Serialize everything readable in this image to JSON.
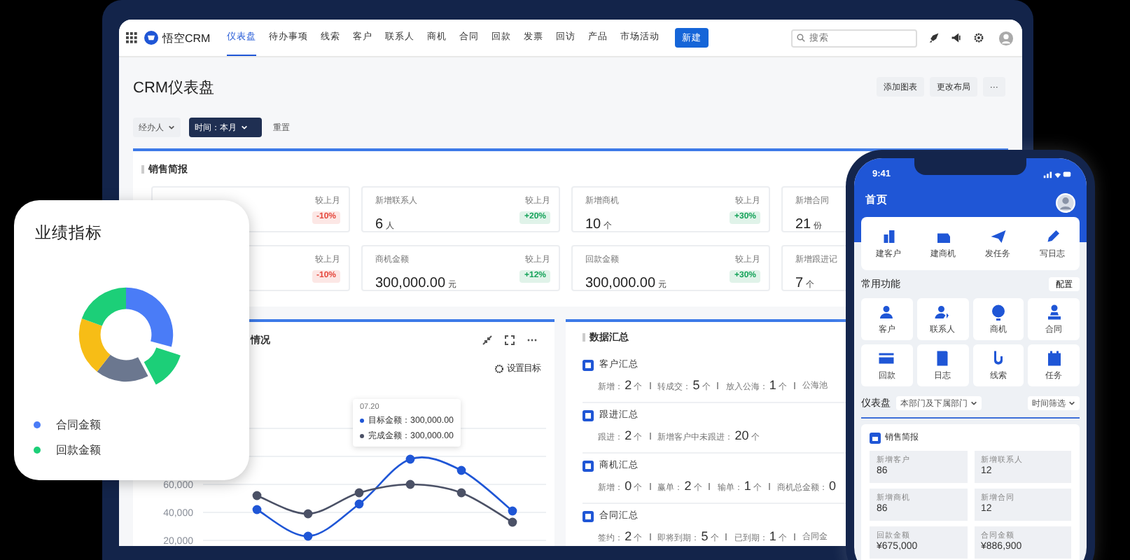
{
  "nav": {
    "app_name": "悟空CRM",
    "tabs": [
      {
        "label": "仪表盘",
        "selected": true
      },
      {
        "label": "待办事项",
        "selected": false
      },
      {
        "label": "线索",
        "selected": false
      },
      {
        "label": "客户",
        "selected": false
      },
      {
        "label": "联系人",
        "selected": false
      },
      {
        "label": "商机",
        "selected": false
      },
      {
        "label": "合同",
        "selected": false
      },
      {
        "label": "回款",
        "selected": false
      },
      {
        "label": "发票",
        "selected": false
      },
      {
        "label": "回访",
        "selected": false
      },
      {
        "label": "产品",
        "selected": false
      },
      {
        "label": "市场活动",
        "selected": false
      }
    ],
    "new_button": "新建",
    "search": {
      "placeholder": "搜索"
    }
  },
  "page": {
    "title": "CRM仪表盘",
    "buttons": [
      "添加图表",
      "更改布局",
      "···"
    ],
    "filters": [
      {
        "label": "经办人",
        "kind": "plain"
      },
      {
        "label": "时间：本月",
        "kind": "active"
      }
    ],
    "reset": "重置"
  },
  "sales_brief": {
    "title": "销售简报",
    "stats": [
      {
        "compare": "较上月",
        "change": "-10%",
        "color": "#e5483d"
      },
      {
        "label": "新增联系人",
        "value": "6",
        "unit": "人",
        "compare": "较上月",
        "change": "+20%",
        "color": "#16a35a"
      },
      {
        "label": "新增商机",
        "value": "10",
        "unit": "个",
        "compare": "较上月",
        "change": "+30%",
        "color": "#16a35a"
      },
      {
        "label": "新增合同",
        "value": "21",
        "unit": "份"
      },
      {
        "compare": "较上月",
        "change": "-10%",
        "color": "#e5483d"
      },
      {
        "label": "商机金额",
        "value": "300,000.00",
        "unit": "元",
        "compare": "较上月",
        "change": "+12%",
        "color": "#16a35a"
      },
      {
        "label": "回款金额",
        "value": "300,000.00",
        "unit": "元",
        "compare": "较上月",
        "change": "+30%",
        "color": "#16a35a"
      },
      {
        "label": "新增跟进记",
        "value": "7",
        "unit": "个"
      }
    ]
  },
  "chart_panel": {
    "title": "情况",
    "action": "设置目标",
    "chart_data": {
      "type": "line",
      "grid": true,
      "ylim": [
        20000,
        100000
      ],
      "series": [
        {
          "name": "目标金额",
          "color": "#1f56d6",
          "marker": "circle",
          "values": [
            null,
            42000,
            23000,
            46000,
            78000,
            70000,
            41000
          ]
        },
        {
          "name": "完成金额",
          "color": "#4b5166",
          "marker": "circle",
          "values": [
            null,
            52000,
            39000,
            54000,
            60000,
            54000,
            33000
          ]
        }
      ],
      "yticks": [
        {
          "value": 20000,
          "label": "20,000"
        },
        {
          "value": 40000,
          "label": "40,000"
        },
        {
          "value": 60000,
          "label": "60,000"
        }
      ]
    },
    "tooltip": {
      "date": "07.20",
      "amounts": [
        "：300,000.00",
        "：300,000.00"
      ]
    }
  },
  "summary": {
    "title": "数据汇总",
    "sections": [
      {
        "title": "客户汇总",
        "items": [
          {
            "label": "新增：",
            "value": "2",
            "unit": "个"
          },
          {
            "label": "转成交：",
            "value": "5",
            "unit": "个"
          },
          {
            "label": "放入公海：",
            "value": "1",
            "unit": "个"
          },
          {
            "label": "公海池"
          }
        ]
      },
      {
        "title": "跟进汇总",
        "items": [
          {
            "label": "跟进：",
            "value": "2",
            "unit": "个"
          },
          {
            "label": "新增客户中未跟进：",
            "value": "20",
            "unit": "个"
          }
        ]
      },
      {
        "title": "商机汇总",
        "items": [
          {
            "label": "新增：",
            "value": "0",
            "unit": "个"
          },
          {
            "label": "赢单：",
            "value": "2",
            "unit": "个"
          },
          {
            "label": "输单：",
            "value": "1",
            "unit": "个"
          },
          {
            "label": "商机总金额：",
            "value": "0"
          }
        ]
      },
      {
        "title": "合同汇总",
        "items": [
          {
            "label": "签约：",
            "value": "2",
            "unit": "个"
          },
          {
            "label": "即将到期：",
            "value": "5",
            "unit": "个"
          },
          {
            "label": "已到期：",
            "value": "1",
            "unit": "个"
          },
          {
            "label": "合同金"
          }
        ]
      }
    ]
  },
  "widget": {
    "title": "业绩指标",
    "legend": [
      {
        "label": "合同金额",
        "color": "#4a7cf7"
      },
      {
        "label": "回款金额",
        "color": "#1ccf78"
      }
    ]
  },
  "phone": {
    "time": "9:41",
    "title": "首页",
    "quick": [
      "建客户",
      "建商机",
      "发任务",
      "写日志"
    ],
    "common": {
      "title": "常用功能",
      "config": "配置",
      "items": [
        "客户",
        "联系人",
        "商机",
        "合同",
        "回款",
        "日志",
        "线索",
        "任务"
      ]
    },
    "dashboard": {
      "title": "仪表盘",
      "scope": "本部门及下属部门",
      "filter": "时间筛选"
    },
    "brief": {
      "title": "销售简报",
      "stats": [
        {
          "label": "新增客户",
          "value": "86"
        },
        {
          "label": "新增联系人",
          "value": "12"
        },
        {
          "label": "新增商机",
          "value": "86"
        },
        {
          "label": "新增合同",
          "value": "12"
        },
        {
          "label": "回款金额",
          "value": "¥675,000"
        },
        {
          "label": "合同金额",
          "value": "¥886,900"
        }
      ]
    }
  }
}
